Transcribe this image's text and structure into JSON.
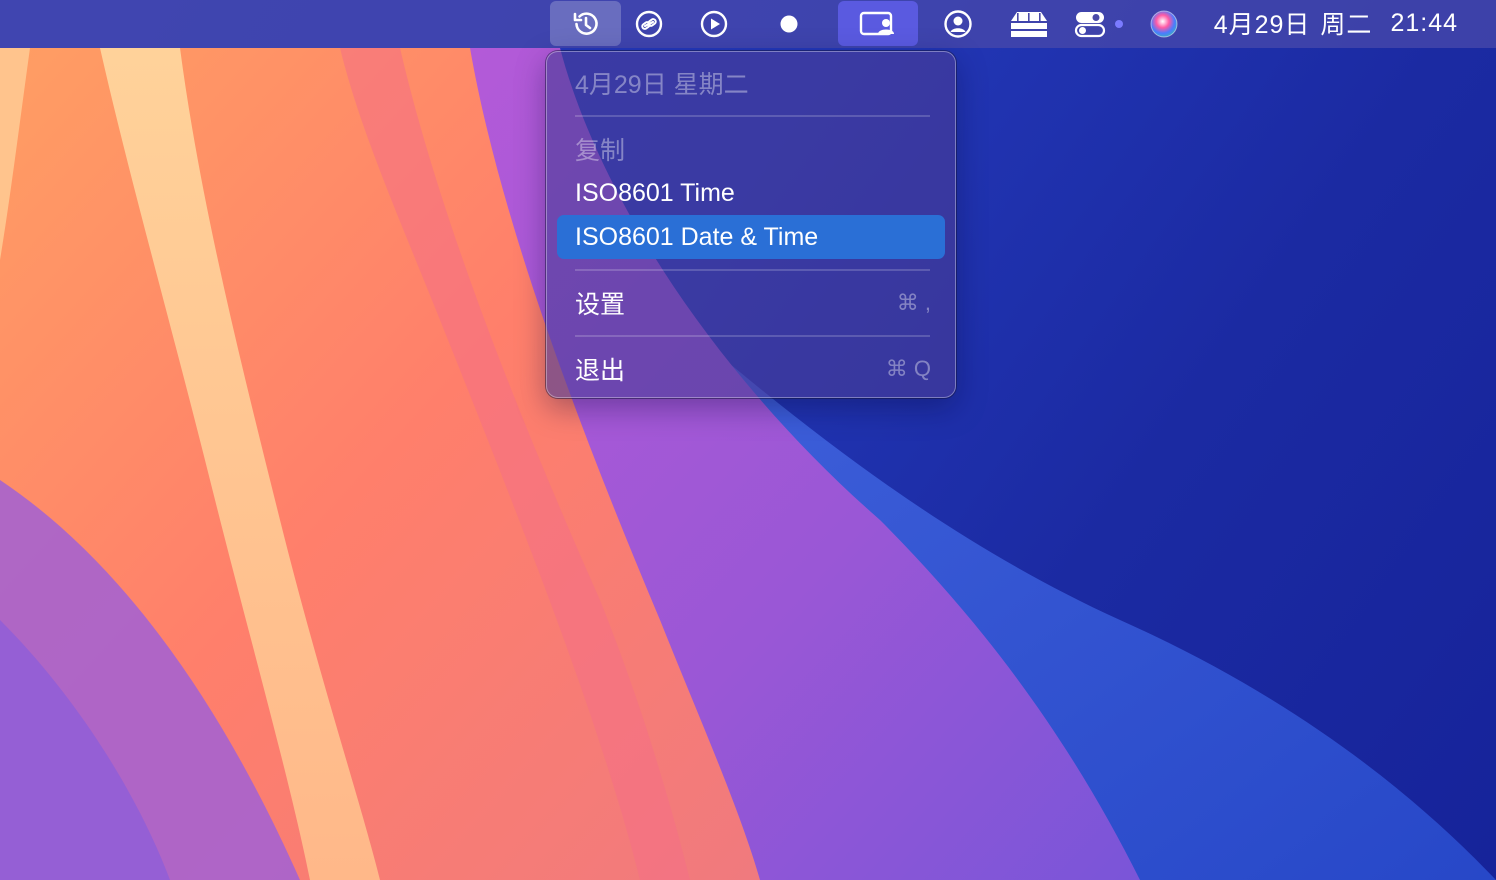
{
  "menubar": {
    "icons": [
      "history-icon",
      "link-icon",
      "play-icon",
      "dot-icon",
      "screen-share-icon",
      "account-icon",
      "stacks-icon",
      "control-center-icon",
      "siri-icon"
    ],
    "date_label": "4月29日",
    "weekday_label": "周二",
    "time_label": "21:44"
  },
  "menu": {
    "date_header": "4月29日 星期二",
    "copy_header": "复制",
    "item_iso_time": "ISO8601 Time",
    "item_iso_datetime": "ISO8601 Date & Time",
    "settings_label": "设置",
    "settings_shortcut": "⌘ ,",
    "quit_label": "退出",
    "quit_shortcut": "⌘ Q"
  },
  "colors": {
    "highlight": "#2a6fd6",
    "menubar_active": "#5a5ae0"
  }
}
